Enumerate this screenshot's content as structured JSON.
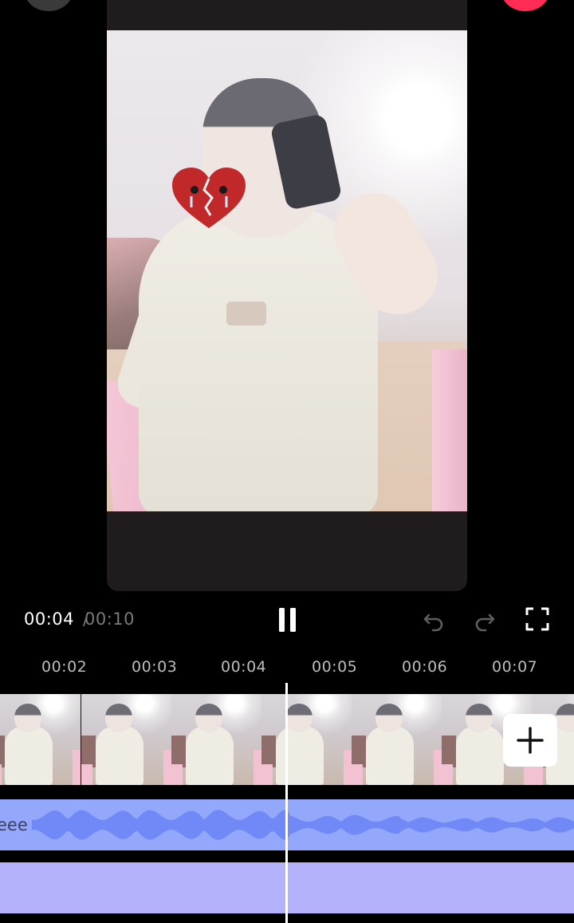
{
  "player": {
    "current_time": "00:04",
    "separator": "/",
    "total_time": "00:10",
    "pause_icon": "pause-icon",
    "undo_icon": "undo-icon",
    "redo_icon": "redo-icon",
    "fullscreen_icon": "fullscreen-icon"
  },
  "ruler": {
    "labels": [
      "00:02",
      "00:03",
      "00:04",
      "00:05",
      "00:06",
      "00:07"
    ]
  },
  "timeline": {
    "video_track_clips": 7,
    "add_clip_icon": "plus-icon",
    "audio_label": "eee",
    "playhead_time": "00:04"
  },
  "colors": {
    "accent_red": "#ff2d55",
    "audio_track": "#93a7fb",
    "audio_wave": "#7189f7",
    "text_track": "#b3b2fb",
    "background": "#000000"
  }
}
